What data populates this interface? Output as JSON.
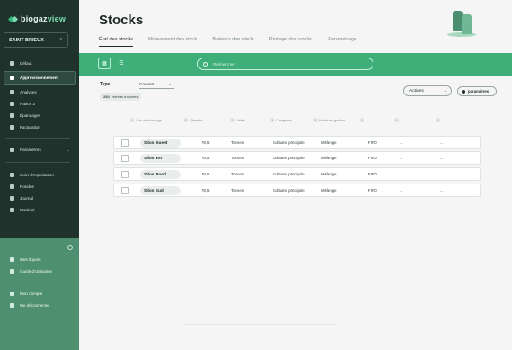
{
  "brand": {
    "name_prefix": "biogaz",
    "name_suffix": "view"
  },
  "farm": {
    "name": "SAINT BRIEUX"
  },
  "sidebar": {
    "items": [
      {
        "label": "Défaut",
        "icon": "grid-icon"
      },
      {
        "label": "Approvisionnement",
        "icon": "box-icon",
        "active": true
      },
      {
        "label": "Analyses",
        "icon": "flask-icon"
      },
      {
        "label": "Ration 2",
        "icon": "ration-icon"
      },
      {
        "label": "Épandages",
        "icon": "tractor-icon"
      },
      {
        "label": "Facturation",
        "icon": "invoice-icon"
      }
    ],
    "parametres": {
      "label": "Paramètres",
      "icon": "gear-icon"
    },
    "secondary": [
      {
        "label": "Suivi d'exploitation",
        "icon": "chart-icon"
      },
      {
        "label": "Rondes",
        "icon": "route-icon"
      },
      {
        "label": "Journal",
        "icon": "book-icon"
      },
      {
        "label": "Matériel",
        "icon": "tool-icon"
      }
    ],
    "bottom": [
      {
        "label": "Mes tiquets",
        "icon": "ticket-icon"
      },
      {
        "label": "Guide d'utilisation",
        "icon": "help-icon"
      },
      {
        "label": "Mon compte",
        "icon": "user-icon"
      },
      {
        "label": "Me déconnecter",
        "icon": "logout-icon"
      }
    ]
  },
  "page": {
    "title": "Stocks"
  },
  "tabs": [
    {
      "label": "État des stocks",
      "active": true
    },
    {
      "label": "Mouvement des stock"
    },
    {
      "label": "Balance des stock"
    },
    {
      "label": "Pilotage des stocks"
    },
    {
      "label": "Paramétrage"
    }
  ],
  "search": {
    "placeholder": "Rechercher"
  },
  "filter": {
    "label": "Type",
    "value": "Courant"
  },
  "count": {
    "number": "284",
    "text": "entrées trouvées"
  },
  "actions": {
    "label": "Actions",
    "params_label": "paramètres"
  },
  "table": {
    "columns": [
      "Lieu de stockage",
      "Quantité",
      "Unité",
      "Catégorie",
      "Mode de gestion",
      "...",
      "...",
      "..."
    ],
    "rows": [
      {
        "lieu": "Silos Ouest",
        "quantite": "78,5",
        "unite": "Tonnes",
        "categorie": "Cultures principale",
        "mode": "Mélange",
        "gestion": "FIFO",
        "c1": "...",
        "c2": "..."
      },
      {
        "lieu": "Silos Est",
        "quantite": "78,5",
        "unite": "Tonnes",
        "categorie": "Cultures principale",
        "mode": "Mélange",
        "gestion": "FIFO",
        "c1": "...",
        "c2": "..."
      },
      {
        "lieu": "Silos Nord",
        "quantite": "78,5",
        "unite": "Tonnes",
        "categorie": "Cultures principale",
        "mode": "Mélange",
        "gestion": "FIFO",
        "c1": "...",
        "c2": "..."
      },
      {
        "lieu": "Silos Sud",
        "quantite": "78,5",
        "unite": "Tonnes",
        "categorie": "Cultures principale",
        "mode": "Mélange",
        "gestion": "FIFO",
        "c1": "...",
        "c2": "..."
      }
    ]
  },
  "colors": {
    "sidebar": "#1f332c",
    "accent": "#3fae79",
    "sidebar_bottom": "#4e8f6f"
  }
}
